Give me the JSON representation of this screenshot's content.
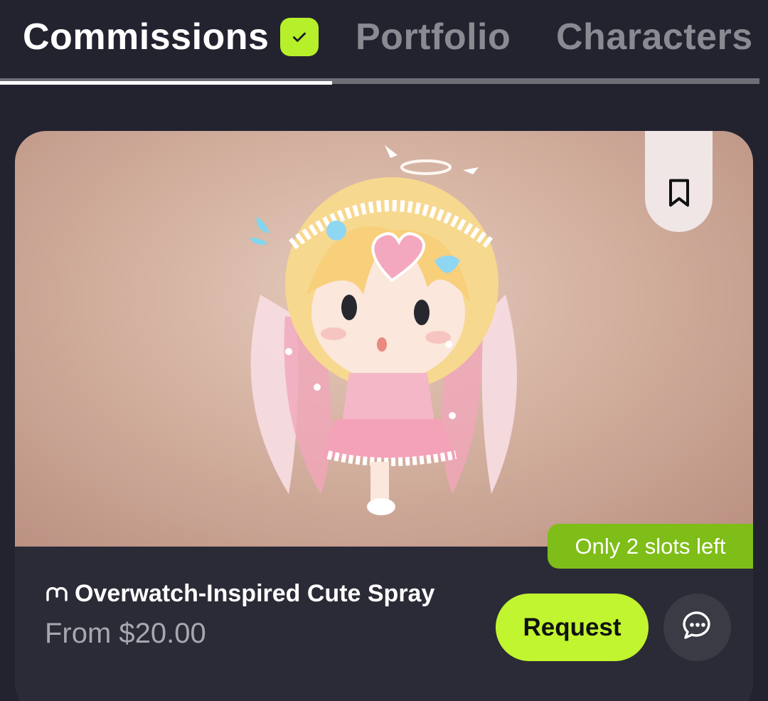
{
  "tabs": [
    {
      "label": "Commissions",
      "active": true,
      "verified_icon": "check-icon"
    },
    {
      "label": "Portfolio",
      "active": false
    },
    {
      "label": "Characters",
      "active": false
    }
  ],
  "colors": {
    "background": "#232330",
    "accent": "#c1f52f",
    "badge_green": "#7fbd19",
    "muted_text": "#a7a7b0"
  },
  "commission": {
    "image_alt": "chibi character artwork",
    "bookmark_icon": "bookmark-icon",
    "slots_label": "Only 2 slots left",
    "title_icon": "creator-logo-icon",
    "title": "Overwatch-Inspired Cute Spray",
    "price": "From $20.00",
    "request_label": "Request",
    "chat_icon": "chat-bubble-icon"
  }
}
